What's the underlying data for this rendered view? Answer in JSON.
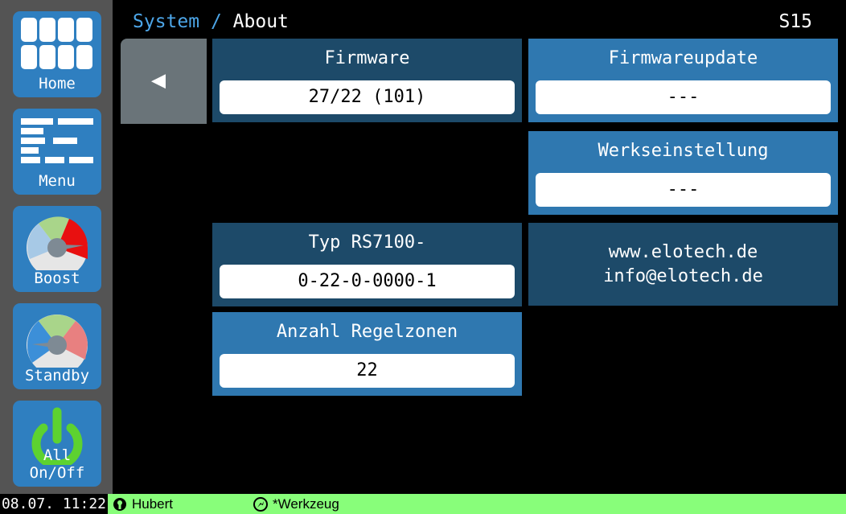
{
  "sidebar": {
    "home_label": "Home",
    "menu_label": "Menu",
    "boost_label": "Boost",
    "standby_label": "Standby",
    "allonoff_label": "All On/Off"
  },
  "header": {
    "section": "System",
    "separator": "/",
    "page": "About",
    "page_number": "S15"
  },
  "back_glyph": "◀",
  "firmware": {
    "title": "Firmware",
    "value": "27/22 (101)"
  },
  "firmwareupdate": {
    "title": "Firmwareupdate",
    "value": "---"
  },
  "werkseinstellung": {
    "title": "Werkseinstellung",
    "value": "---"
  },
  "typ": {
    "title": "Typ RS7100-",
    "value": "0-22-0-0000-1"
  },
  "zonen": {
    "title": "Anzahl Regelzonen",
    "value": "22"
  },
  "contact": {
    "web": "www.elotech.de",
    "mail": "info@elotech.de"
  },
  "status": {
    "datetime": "08.07. 11:22",
    "user": "Hubert",
    "tool": "*Werkzeug"
  },
  "colors": {
    "accent": "#2f78b0",
    "dark_panel": "#1d4a69",
    "status_bar": "#88fe7a"
  }
}
